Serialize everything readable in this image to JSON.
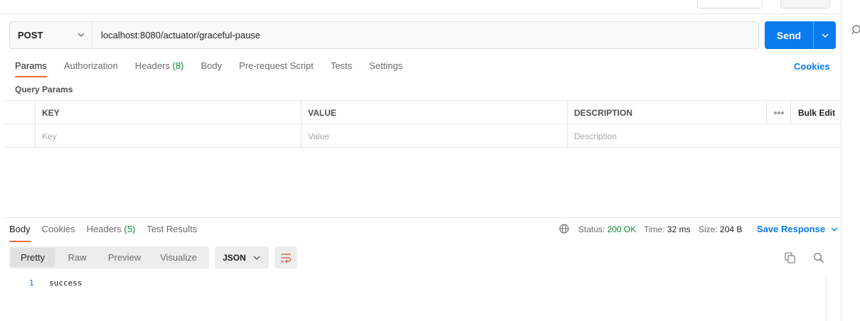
{
  "request": {
    "method": "POST",
    "url": "localhost:8080/actuator/graceful-pause",
    "send_label": "Send"
  },
  "request_tabs": [
    {
      "label": "Params",
      "count": "",
      "active": true
    },
    {
      "label": "Authorization",
      "count": "",
      "active": false
    },
    {
      "label": "Headers",
      "count": "(8)",
      "active": false
    },
    {
      "label": "Body",
      "count": "",
      "active": false
    },
    {
      "label": "Pre-request Script",
      "count": "",
      "active": false
    },
    {
      "label": "Tests",
      "count": "",
      "active": false
    },
    {
      "label": "Settings",
      "count": "",
      "active": false
    }
  ],
  "cookies_label": "Cookies",
  "query_params": {
    "title": "Query Params",
    "headers": {
      "key": "KEY",
      "value": "VALUE",
      "description": "DESCRIPTION",
      "more": "ooo",
      "bulk_edit": "Bulk Edit"
    },
    "placeholders": {
      "key": "Key",
      "value": "Value",
      "description": "Description"
    }
  },
  "response_tabs": [
    {
      "label": "Body",
      "count": "",
      "active": true
    },
    {
      "label": "Cookies",
      "count": "",
      "active": false
    },
    {
      "label": "Headers",
      "count": "(5)",
      "active": false
    },
    {
      "label": "Test Results",
      "count": "",
      "active": false
    }
  ],
  "response_meta": {
    "status_label": "Status:",
    "status_value": "200 OK",
    "time_label": "Time:",
    "time_value": "32 ms",
    "size_label": "Size:",
    "size_value": "204 B",
    "save_label": "Save Response"
  },
  "view_modes": [
    "Pretty",
    "Raw",
    "Preview",
    "Visualize"
  ],
  "active_view": "Pretty",
  "format": "JSON",
  "body_lines": [
    {
      "number": "1",
      "text": "success"
    }
  ],
  "icons": {
    "method_dropdown": "chevron-down-icon",
    "send_dropdown": "chevron-down-icon",
    "globe": "globe-icon",
    "wrap": "word-wrap-icon",
    "copy": "copy-icon",
    "search": "search-icon"
  },
  "colors": {
    "accent_orange": "#ff6c37",
    "primary_blue": "#097bed",
    "success_green": "#0a8a35"
  }
}
